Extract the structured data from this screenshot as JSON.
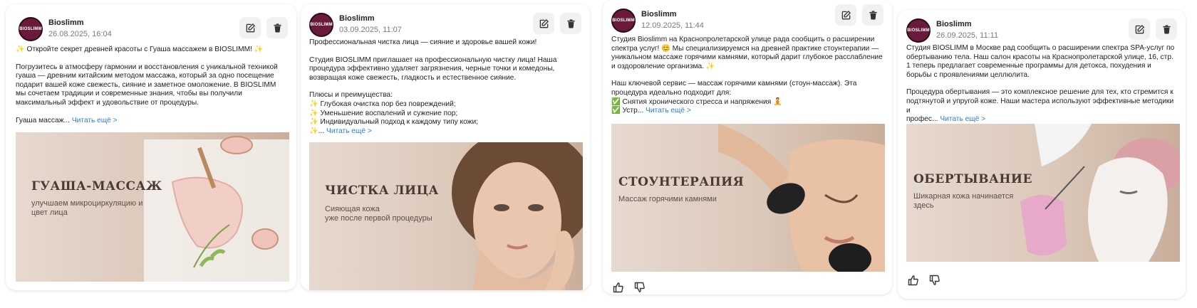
{
  "posts": [
    {
      "author": "Bioslimm",
      "date": "26.08.2025, 16:04",
      "avatar_text": "BIOSLIMM",
      "paragraphs": [
        "✨ Откройте секрет древней красоты с Гуаша массажем в BIOSLIMM! ✨",
        "Погрузитесь в атмосферу гармонии и восстановления с уникальной техникой гуаша — древним китайским методом массажа, который за одно посещение подарит вашей коже свежесть, сияние и заметное омоложение. В BIOSLIMM мы сочетаем традиции и современные знания, чтобы вы получили максимальный эффект и удовольствие от процедуры."
      ],
      "preview_line": "Гуаша массаж...",
      "read_more": "Читать ещё >",
      "banner_title": "ГУАША-МАССАЖ",
      "banner_subtitle": "улучшаем микроциркуляцию и цвет лица"
    },
    {
      "author": "Bioslimm",
      "date": "03.09.2025, 11:07",
      "avatar_text": "BIOSLIMM",
      "paragraphs": [
        "Профессиональная чистка лица — сияние и здоровье вашей кожи!",
        "Студия BIOSLIMM приглашает на профессиональную чистку лица! Наша процедура эффективно удаляет загрязнения, черные точки и комедоны, возвращая коже свежесть, гладкость и естественное сияние.",
        "Плюсы и преимущества:"
      ],
      "list": [
        "✨ Глубокая очистка пор без повреждений;",
        "✨ Уменьшение воспалений и сужение пор;",
        "✨ Индивидуальный подход к каждому типу кожи;"
      ],
      "preview_line": "✨...",
      "read_more": "Читать ещё >",
      "banner_title": "ЧИСТКА ЛИЦА",
      "banner_subtitle_1": "Сияющая кожа",
      "banner_subtitle_2": "уже после первой процедуры"
    },
    {
      "author": "Bioslimm",
      "date": "12.09.2025, 11:44",
      "avatar_text": "BIOSLIMM",
      "paragraphs": [
        "Студия Bioslimm на Краснопролетарской улице рада сообщить о расширении спектра услуг! 😊 Мы специализируемся на древней практике стоунтерапии — уникальном массаже горячими камнями, который дарит глубокое расслабление и оздоровление организма. ✨",
        "Наш ключевой сервис — массаж горячими камнями (стоун-массаж). Эта процедура идеально подходит для:"
      ],
      "list": [
        "✅ Снятия хронического стресса и напряжения 🧘"
      ],
      "preview_line": "✅ Устр...",
      "read_more": "Читать ещё >",
      "banner_title": "СТОУНТЕРАПИЯ",
      "banner_subtitle": "Массаж горячими камнями"
    },
    {
      "author": "Bioslimm",
      "date": "26.09.2025, 11:11",
      "avatar_text": "BIOSLIMM",
      "paragraphs": [
        "Студия BIOSLIMM в Москве рад сообщить о расширении спектра SPA-услуг по обертыванию тела. Наш салон красоты на Краснопролетарской улице, 16, стр. 1 теперь предлагает современные программы для детокса, похудения и борьбы с проявлениями целлюлита.",
        "Процедура обертывания — это комплексное решение для тех, кто стремится к подтянутой и упругой коже. Наши мастера используют эффективные методики и"
      ],
      "preview_line": "профес...",
      "read_more": "Читать ещё >",
      "banner_title": "ОБЕРТЫВАНИЕ",
      "banner_subtitle_1": "Шикарная кожа начинается",
      "banner_subtitle_2": "здесь"
    }
  ]
}
